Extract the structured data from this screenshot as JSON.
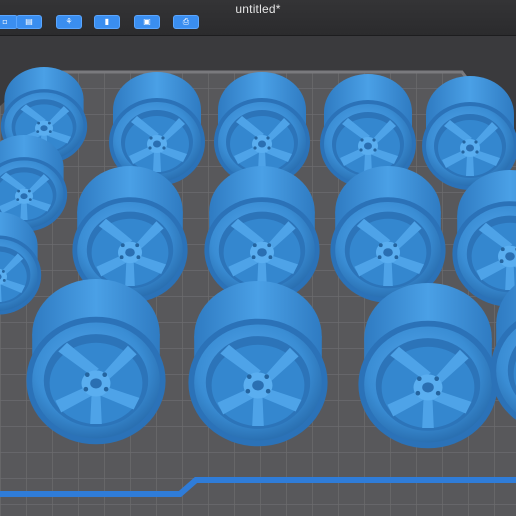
{
  "window": {
    "title": "untitled*"
  },
  "toolbar": {
    "buttons": [
      {
        "name": "partial-button",
        "icon": "partial-icon"
      },
      {
        "name": "file-button",
        "icon": "file-icon"
      },
      {
        "name": "supports-button",
        "icon": "supports-icon"
      },
      {
        "name": "resin-button",
        "icon": "bottle-icon"
      },
      {
        "name": "layout-button",
        "icon": "grid-square-icon"
      },
      {
        "name": "slice-button",
        "icon": "printer-icon"
      }
    ]
  },
  "build_plate": {
    "plate_color": "#555558",
    "grid_color": "#6a6a6d",
    "border_color": "#2f7cd8",
    "model_color": "#3b8fd6",
    "models": [
      {
        "row": 1,
        "count": 4
      },
      {
        "row": 2,
        "count": 4
      },
      {
        "row": 3,
        "count": 4
      },
      {
        "row": 0,
        "count": 3
      }
    ]
  }
}
